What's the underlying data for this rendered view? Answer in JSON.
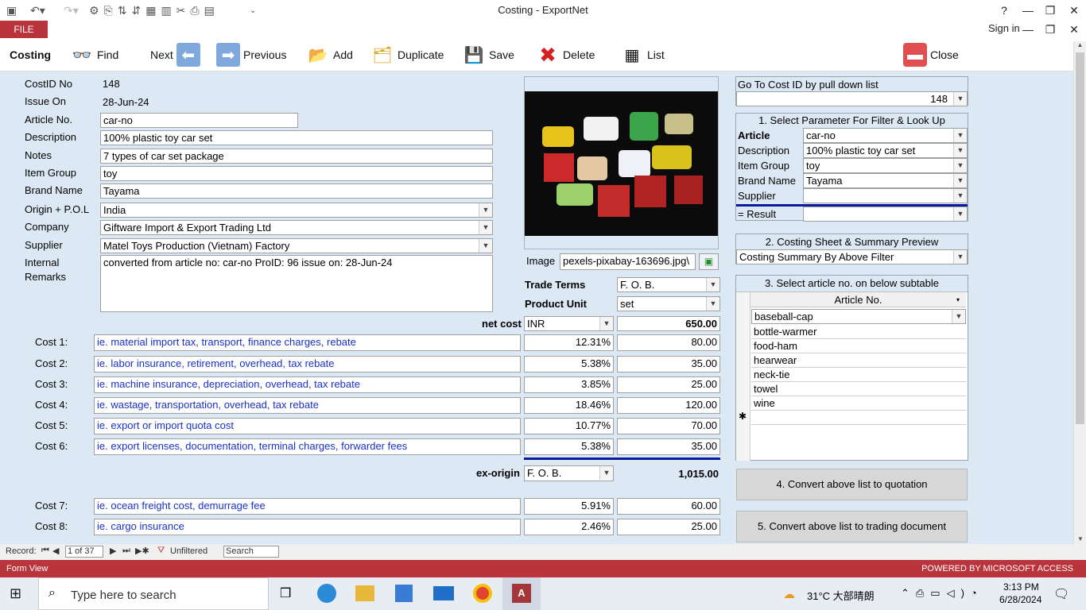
{
  "window": {
    "title": "Costing - ExportNet",
    "help": "?",
    "file_tab": "FILE",
    "sign_in": "Sign in"
  },
  "toolbar": {
    "form_name": "Costing",
    "find": "Find",
    "next": "Next",
    "previous": "Previous",
    "add": "Add",
    "duplicate": "Duplicate",
    "save": "Save",
    "delete": "Delete",
    "list": "List",
    "close": "Close"
  },
  "record": {
    "cost_id_label": "CostID No",
    "cost_id": "148",
    "issue_on_label": "Issue On",
    "issue_on": "28-Jun-24",
    "article_no_label": "Article No.",
    "article_no": "car-no",
    "description_label": "Description",
    "description": "100% plastic toy car set",
    "notes_label": "Notes",
    "notes": "7 types of car set package",
    "item_group_label": "Item Group",
    "item_group": "toy",
    "brand_name_label": "Brand Name",
    "brand_name": "Tayama",
    "origin_label": "Origin + P.O.L",
    "origin": "India",
    "company_label": "Company",
    "company": "Giftware Import & Export Trading Ltd",
    "supplier_label": "Supplier",
    "supplier": "Matel Toys Production (Vietnam) Factory",
    "remarks_label_1": "Internal",
    "remarks_label_2": "Remarks",
    "remarks": "converted from article no: car-no ProID: 96  issue on: 28-Jun-24",
    "image_label": "Image",
    "image_file": "\\pexels-pixabay-163696.jpg",
    "trade_terms_label": "Trade Terms",
    "trade_terms": "F. O. B.",
    "product_unit_label": "Product Unit",
    "product_unit": "set",
    "net_cost_label": "net cost",
    "currency": "INR",
    "net_cost": "650.00",
    "ex_origin_label": "ex-origin",
    "ex_origin_terms": "F. O. B.",
    "ex_origin_value": "1,015.00"
  },
  "costs": [
    {
      "label": "Cost 1:",
      "desc": "ie. material import tax, transport, finance charges, rebate",
      "pct": "12.31%",
      "amount": "80.00"
    },
    {
      "label": "Cost 2:",
      "desc": "ie. labor insurance, retirement, overhead, tax rebate",
      "pct": "5.38%",
      "amount": "35.00"
    },
    {
      "label": "Cost 3:",
      "desc": "ie. machine insurance, depreciation, overhead, tax rebate",
      "pct": "3.85%",
      "amount": "25.00"
    },
    {
      "label": "Cost 4:",
      "desc": "ie. wastage, transportation, overhead, tax rebate",
      "pct": "18.46%",
      "amount": "120.00"
    },
    {
      "label": "Cost 5:",
      "desc": "ie. export or import quota cost",
      "pct": "10.77%",
      "amount": "70.00"
    },
    {
      "label": "Cost 6:",
      "desc": "ie. export licenses, documentation, terminal charges, forwarder fees",
      "pct": "5.38%",
      "amount": "35.00"
    }
  ],
  "costs_after": [
    {
      "label": "Cost 7:",
      "desc": "ie. ocean freight cost, demurrage fee",
      "pct": "5.91%",
      "amount": "60.00"
    },
    {
      "label": "Cost 8:",
      "desc": "ie. cargo insurance",
      "pct": "2.46%",
      "amount": "25.00"
    }
  ],
  "right": {
    "goto_title": "Go To Cost ID by pull down list",
    "goto_value": "148",
    "filter_title": "1. Select Parameter For Filter & Look Up",
    "filter": [
      {
        "label": "Article",
        "value": "car-no"
      },
      {
        "label": "Description",
        "value": "100% plastic toy car set"
      },
      {
        "label": "Item Group",
        "value": "toy"
      },
      {
        "label": "Brand Name",
        "value": "Tayama"
      },
      {
        "label": "Supplier",
        "value": ""
      }
    ],
    "result_label": "= Result",
    "result_value": "",
    "preview_title": "2. Costing Sheet & Summary Preview",
    "preview_value": "Costing Summary By Above Filter",
    "subtable_title": "3. Select article no.  on below subtable",
    "subtable_header": "Article No.",
    "subtable_rows": [
      "baseball-cap",
      "bottle-warmer",
      "food-ham",
      "hearwear",
      "neck-tie",
      "towel",
      "wine"
    ],
    "new_row_marker": "✱",
    "btn_quotation": "4. Convert above list to quotation",
    "btn_trading": "5. Convert above list to trading document"
  },
  "navbar": {
    "record_label": "Record:",
    "position": "1 of 37",
    "filter": "Unfiltered",
    "search": "Search"
  },
  "status": {
    "left": "Form View",
    "right": "POWERED BY MICROSOFT ACCESS"
  },
  "taskbar": {
    "search_placeholder": "Type here to search",
    "weather": "31°C  大部晴朗",
    "time": "3:13 PM",
    "date": "6/28/2024"
  }
}
